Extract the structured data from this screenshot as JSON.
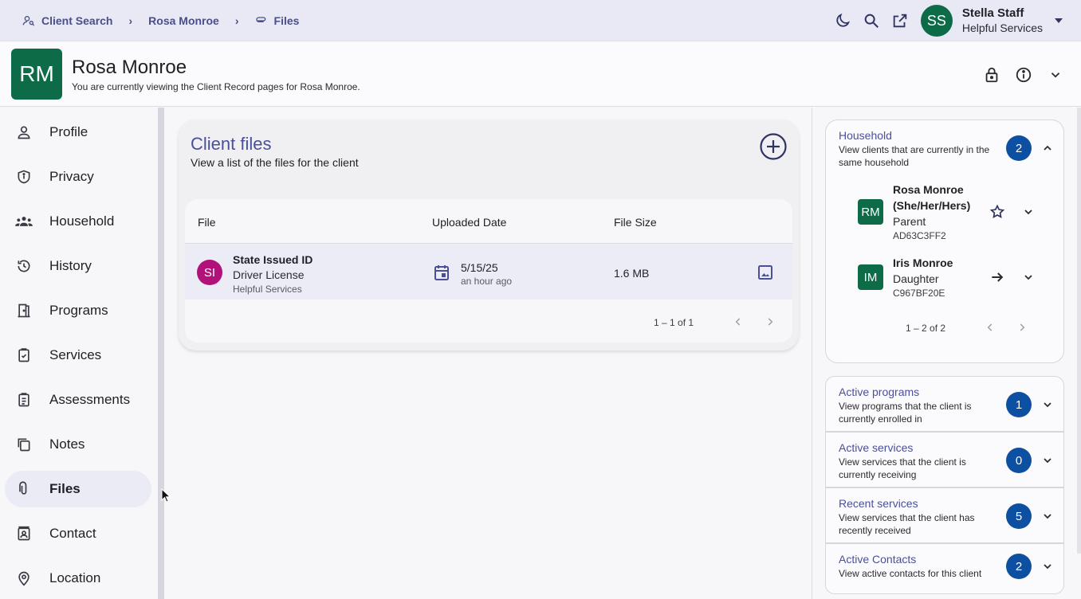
{
  "breadcrumb": {
    "items": [
      {
        "label": "Client Search",
        "icon": "person-search-icon"
      },
      {
        "label": "Rosa Monroe",
        "icon": ""
      },
      {
        "label": "Files",
        "icon": "paperclip-icon"
      }
    ],
    "separator": "›"
  },
  "user": {
    "initials": "SS",
    "name": "Stella Staff",
    "org": "Helpful Services"
  },
  "client": {
    "initials": "RM",
    "name": "Rosa Monroe",
    "subtitle": "You are currently viewing the Client Record pages for Rosa Monroe."
  },
  "sidebar": {
    "items": [
      {
        "label": "Profile",
        "icon": "person-icon"
      },
      {
        "label": "Privacy",
        "icon": "shield-icon"
      },
      {
        "label": "Household",
        "icon": "group-icon"
      },
      {
        "label": "History",
        "icon": "history-icon"
      },
      {
        "label": "Programs",
        "icon": "door-icon"
      },
      {
        "label": "Services",
        "icon": "clipboard-check-icon"
      },
      {
        "label": "Assessments",
        "icon": "clipboard-list-icon"
      },
      {
        "label": "Notes",
        "icon": "notes-icon"
      },
      {
        "label": "Files",
        "icon": "paperclip-icon",
        "active": true
      },
      {
        "label": "Contact",
        "icon": "contact-card-icon"
      },
      {
        "label": "Location",
        "icon": "location-pin-icon"
      }
    ]
  },
  "files": {
    "title": "Client files",
    "subtitle": "View a list of the files for the client",
    "columns": {
      "file": "File",
      "uploaded": "Uploaded Date",
      "size": "File Size"
    },
    "rows": [
      {
        "initials": "SI",
        "title": "State Issued ID",
        "type": "Driver License",
        "org": "Helpful Services",
        "date": "5/15/25",
        "relative": "an hour ago",
        "size": "1.6 MB"
      }
    ],
    "pagination": "1 – 1 of 1"
  },
  "household": {
    "title": "Household",
    "subtitle": "View clients that are currently in the same household",
    "count": "2",
    "members": [
      {
        "initials": "RM",
        "name_line1": "Rosa Monroe",
        "name_line2": "(She/Her/Hers)",
        "role": "Parent",
        "id": "AD63C3FF2"
      },
      {
        "initials": "IM",
        "name_line1": "Iris Monroe",
        "name_line2": "",
        "role": "Daughter",
        "id": "C967BF20E"
      }
    ],
    "pagination": "1 – 2 of 2"
  },
  "accordions": [
    {
      "title": "Active programs",
      "subtitle": "View programs that the client is currently enrolled in",
      "count": "1"
    },
    {
      "title": "Active services",
      "subtitle": "View services that the client is currently receiving",
      "count": "0"
    },
    {
      "title": "Recent services",
      "subtitle": "View services that the client has recently received",
      "count": "5"
    },
    {
      "title": "Active Contacts",
      "subtitle": "View active contacts for this client",
      "count": "2"
    }
  ],
  "colors": {
    "brand_green": "#0d6b48",
    "accent_purple": "#4a4f9a",
    "badge_blue": "#0d4fa0",
    "file_avatar": "#b0127a"
  }
}
